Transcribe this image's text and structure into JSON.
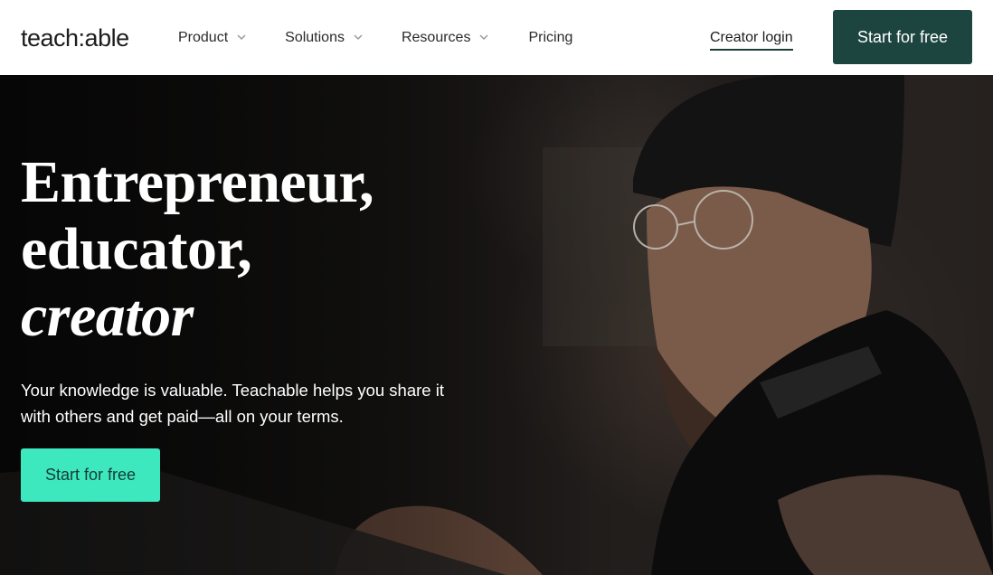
{
  "header": {
    "logo": "teach:able",
    "nav": [
      {
        "label": "Product",
        "has_dropdown": true
      },
      {
        "label": "Solutions",
        "has_dropdown": true
      },
      {
        "label": "Resources",
        "has_dropdown": true
      },
      {
        "label": "Pricing",
        "has_dropdown": false
      }
    ],
    "creator_login": "Creator login",
    "cta_label": "Start for free"
  },
  "hero": {
    "headline_line1": "Entrepreneur,",
    "headline_line2": "educator,",
    "headline_line3": "creator",
    "subtext": "Your knowledge is valuable. Teachable helps you share it with others and get paid—all on your terms.",
    "cta_label": "Start for free"
  },
  "colors": {
    "header_cta_bg": "#1d4540",
    "hero_cta_bg": "#3de8be",
    "hero_cta_text": "#163b35"
  },
  "icons": {
    "dropdown": "chevron-down-icon"
  }
}
